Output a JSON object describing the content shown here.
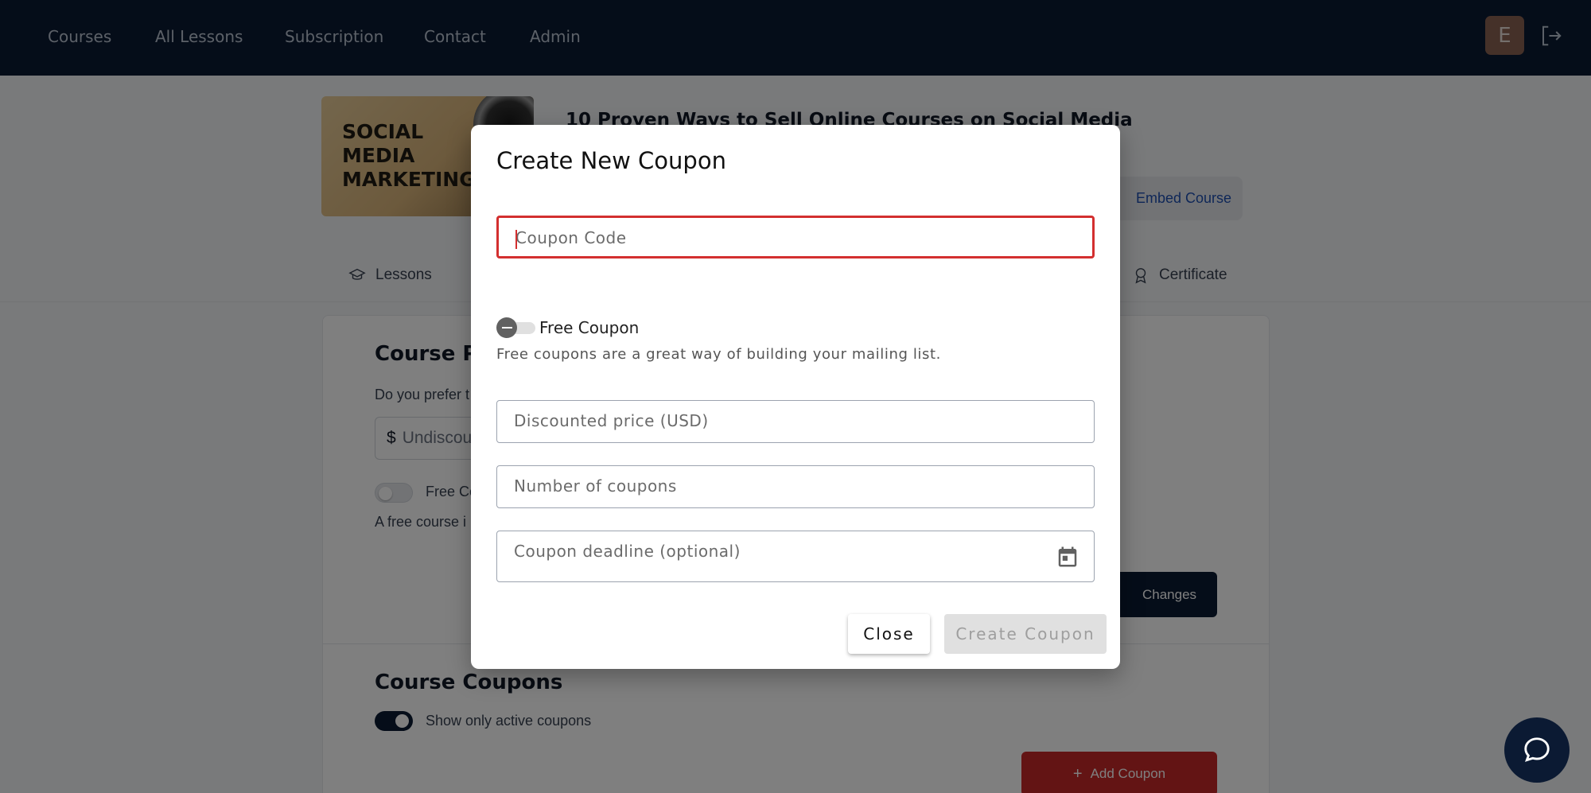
{
  "nav": {
    "items": [
      {
        "label": "Courses"
      },
      {
        "label": "All Lessons"
      },
      {
        "label": "Subscription"
      },
      {
        "label": "Contact"
      },
      {
        "label": "Admin"
      }
    ],
    "avatar_initial": "E",
    "logout_icon": "logout-icon"
  },
  "course": {
    "thumbnail_text": "SOCIAL\nMEDIA\nMARKETING",
    "title": "10 Proven Ways to Sell Online Courses on Social Media",
    "embed_label": "Embed Course"
  },
  "tabs": [
    {
      "label": "Lessons",
      "icon": "graduation-cap-icon"
    },
    {
      "label": "Certificate",
      "icon": "certificate-icon"
    }
  ],
  "pricing": {
    "title": "Course Pri",
    "question": "Do you prefer t",
    "currency": "$",
    "price_placeholder": "Undiscou",
    "free_label": "Free Co",
    "free_help": "A free course i",
    "save_label": "Changes"
  },
  "coupons": {
    "title": "Course Coupons",
    "active_only_label": "Show only active coupons",
    "active_only_on": true,
    "add_label": "Add Coupon"
  },
  "modal": {
    "title": "Create New Coupon",
    "code_placeholder": "Coupon Code",
    "free_label": "Free Coupon",
    "free_on": false,
    "free_help": "Free coupons are a great way of building your mailing list.",
    "discount_placeholder": "Discounted price (USD)",
    "count_placeholder": "Number of coupons",
    "deadline_placeholder": "Coupon deadline (optional)",
    "close_label": "Close",
    "create_label": "Create Coupon"
  },
  "colors": {
    "nav_bg": "#0b1a33",
    "error": "#d32f2f",
    "accent_red": "#c62828",
    "link_blue": "#1e4fb0"
  }
}
